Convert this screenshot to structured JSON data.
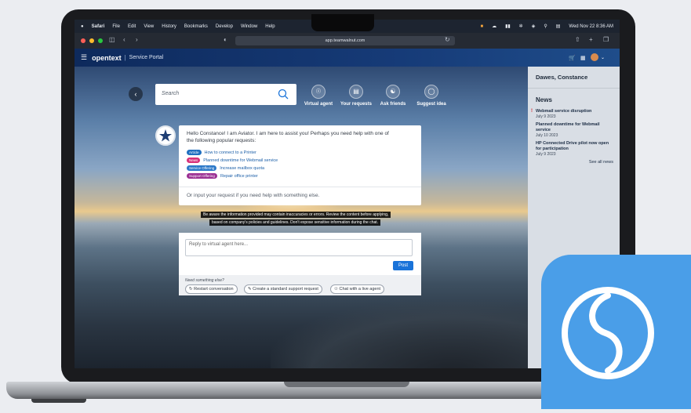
{
  "menubar": {
    "apple": "",
    "items": [
      "Safari",
      "File",
      "Edit",
      "View",
      "History",
      "Bookmarks",
      "Develop",
      "Window",
      "Help"
    ],
    "datetime": "Wed Nov 22  8:36 AM"
  },
  "browser": {
    "url": "app.teamwalnut.com"
  },
  "portal": {
    "brand": "opentext",
    "section": "Service Portal"
  },
  "search": {
    "placeholder": "Search"
  },
  "quick_actions": [
    {
      "label": "Virtual agent"
    },
    {
      "label": "Your requests"
    },
    {
      "label": "Ask friends"
    },
    {
      "label": "Suggest idea"
    }
  ],
  "chat": {
    "greeting": "Hello Constance! I am Aviator. I am here to assist you! Perhaps you need help with one of the following popular requests:",
    "requests": [
      {
        "badge": "Article",
        "badge_color": "#1f6fc0",
        "text": "How to connect to a Printer"
      },
      {
        "badge": "News",
        "badge_color": "#d8327a",
        "text": "Planned downtime for Webmail service"
      },
      {
        "badge": "Service Offering",
        "badge_color": "#2b78c8",
        "text": "Increase mailbox quota"
      },
      {
        "badge": "Support Offering",
        "badge_color": "#9b2f93",
        "text": "Repair office printer"
      }
    ],
    "alt_prompt": "Or input your request if you need help with something else.",
    "disclaimer_line1": "Be aware the information provided may contain inaccuracies or errors. Review the content before applying,",
    "disclaimer_line2": "based on company's policies and guidelines. Don't expose sensitive information during the chat.",
    "reply_placeholder": "Reply to virtual agent here...",
    "post_label": "Post",
    "need_help": "Need something else?",
    "actions": [
      "Restart conversation",
      "Create a standard support request",
      "Chat with a live agent"
    ]
  },
  "side_panel": {
    "user_name": "Dawes, Constance",
    "news_title": "News",
    "news": [
      {
        "title": "Webmail service disruption",
        "date": "July 9 2023",
        "alert": "!"
      },
      {
        "title": "Planned downtime for Webmail service",
        "date": "July 10 2023",
        "alert": ""
      },
      {
        "title": "HP Connected Drive pilot now open for participation",
        "date": "July 9 2023",
        "alert": ""
      }
    ],
    "see_all": "See all news"
  },
  "colors": {
    "header": "#163b78",
    "post_button": "#1a73d9",
    "app_tile": "#4a9ee8"
  }
}
